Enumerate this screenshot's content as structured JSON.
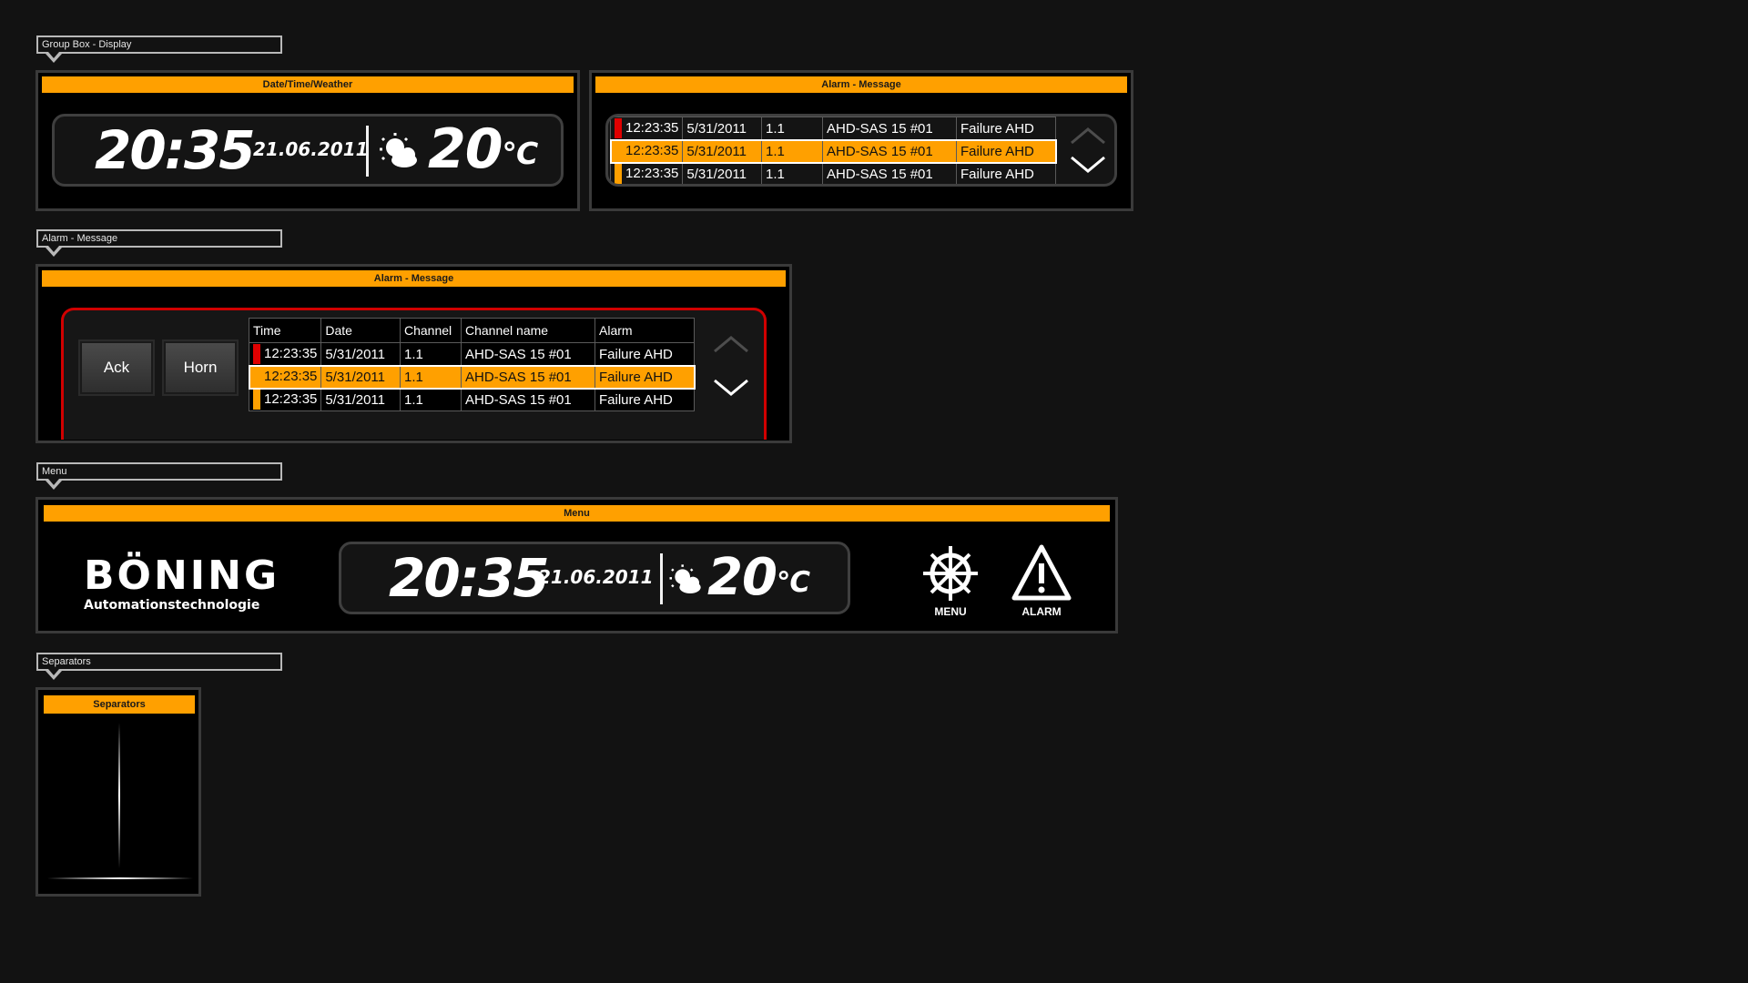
{
  "groups": {
    "display_label": "Group Box - Display",
    "alarm_label": "Alarm - Message",
    "menu_label": "Menu",
    "separators_label": "Separators"
  },
  "panels": {
    "datetime_title": "Date/Time/Weather",
    "alarm_small_title": "Alarm - Message",
    "alarm_big_title": "Alarm - Message",
    "menu_title": "Menu",
    "separators_title": "Separators"
  },
  "clock": {
    "time": "20:35",
    "date": "21.06.2011",
    "temperature": "20",
    "unit": "°C"
  },
  "alarm_table": {
    "headers": [
      "Time",
      "Date",
      "Channel",
      "Channel name",
      "Alarm"
    ],
    "rows": [
      {
        "time": "12:23:35",
        "date": "5/31/2011",
        "channel": "1.1",
        "name": "AHD-SAS 15 #01",
        "alarm": "Failure AHD",
        "marker": "#e00000",
        "selected": false
      },
      {
        "time": "12:23:35",
        "date": "5/31/2011",
        "channel": "1.1",
        "name": "AHD-SAS 15 #01",
        "alarm": "Failure AHD",
        "marker": "#ffa000",
        "selected": true
      },
      {
        "time": "12:23:35",
        "date": "5/31/2011",
        "channel": "1.1",
        "name": "AHD-SAS 15 #01",
        "alarm": "Failure AHD",
        "marker": "#ffa000",
        "selected": false
      }
    ]
  },
  "buttons": {
    "ack": "Ack",
    "horn": "Horn"
  },
  "menu": {
    "brand": "BÖNING",
    "brand_sub": "Automationstechnologie",
    "menu_label": "MENU",
    "alarm_label": "ALARM"
  },
  "colors": {
    "accent": "#ffa000",
    "alarm_red": "#e00000",
    "background": "#121212"
  }
}
